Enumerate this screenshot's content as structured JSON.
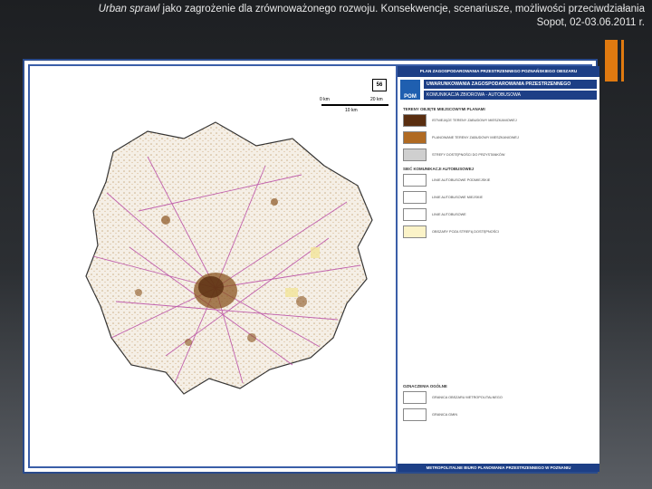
{
  "header": {
    "title_italic": "Urban sprawl",
    "title_rest": " jako zagrożenie dla zrównoważonego rozwoju. Konsekwencje, scenariusze, możliwości przeciwdziałania",
    "subtitle": "Sopot, 02-03.06.2011 r."
  },
  "colors": {
    "accent": "#e07a10",
    "frame": "#3a5ea8",
    "legend_header": "#1d3f86"
  },
  "map": {
    "number": "56",
    "scale_labels": [
      "0 km",
      "10 km",
      "20 km"
    ]
  },
  "legend": {
    "top_banner": "PLAN ZAGOSPODAROWANIA PRZESTRZENNEGO POZNAŃSKIEGO OBSZARU METROPOLITALNEGO",
    "logo_text": "POM",
    "title1": "UWARUNKOWANIA ZAGOSPODAROWANIA PRZESTRZENNEGO",
    "title2": "KOMUNIKACJA ZBIOROWA - AUTOBUSOWA",
    "section1": "TERENY OBJĘTE MIEJSCOWYMI PLANAMI",
    "items1": [
      {
        "label": "ISTNIEJĄCE TERENY ZABUDOWY MIESZKANIOWEJ",
        "color": "#5a2e10"
      },
      {
        "label": "PLANOWANE TERENY ZABUDOWY MIESZKANIOWEJ",
        "color": "#b06a22"
      },
      {
        "label": "STREFY DOSTĘPNOŚCI DO PRZYSTANKÓW",
        "color": "#cfcfcf"
      }
    ],
    "section2": "SIEĆ KOMUNIKACJI AUTOBUSOWEJ",
    "items2": [
      {
        "label": "LINIE AUTOBUSOWE PODMIEJSKIE",
        "color": "#ffffff"
      },
      {
        "label": "LINIE AUTOBUSOWE MIEJSKIE",
        "color": "#ffffff"
      },
      {
        "label": "LINIE AUTOBUSOWE",
        "color": "#ffffff"
      },
      {
        "label": "OBSZARY POZA STREFĄ DOSTĘPNOŚCI",
        "color": "#fbf3c8"
      }
    ],
    "section3": "OZNACZENIA OGÓLNE",
    "items3": [
      {
        "label": "GRANICA OBSZARU METROPOLITALNEGO",
        "color": "#ffffff"
      },
      {
        "label": "GRANICA GMIN",
        "color": "#ffffff"
      }
    ],
    "footer": "METROPOLITALNE BIURO PLANOWANIA PRZESTRZENNEGO W POZNANIU"
  }
}
